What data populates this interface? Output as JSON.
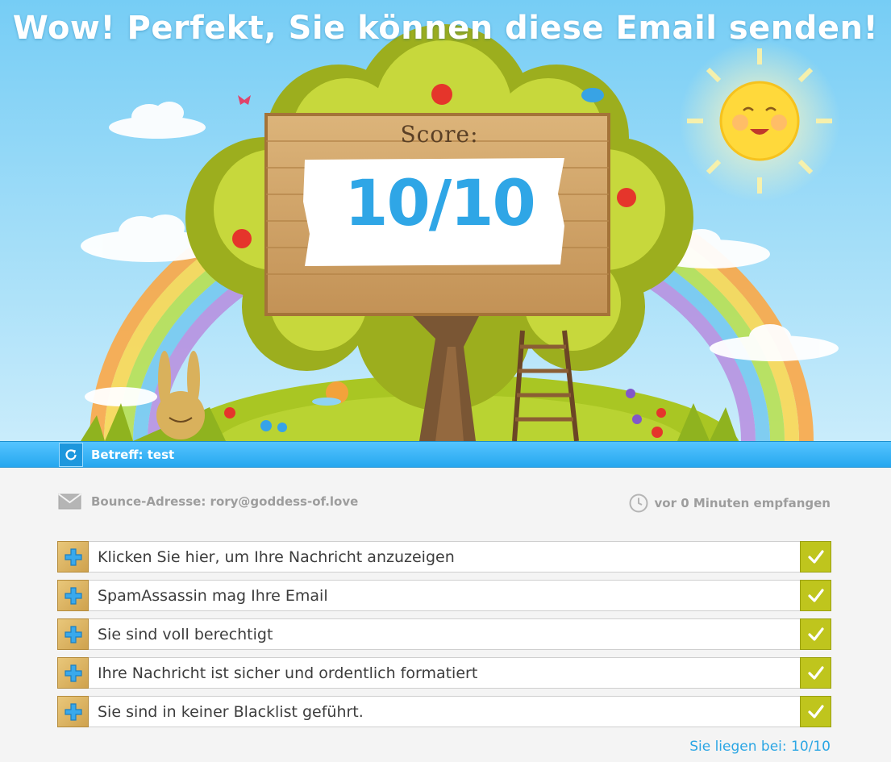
{
  "hero": {
    "headline": "Wow! Perfekt, Sie können diese Email senden!",
    "score_label": "Score:",
    "score_value": "10/10"
  },
  "subject_bar": {
    "subject": "Betreff: test"
  },
  "meta": {
    "bounce": "Bounce-Adresse: rory@goddess-of.love",
    "received": "vor 0 Minuten empfangen"
  },
  "checks": [
    {
      "label": "Klicken Sie hier, um Ihre Nachricht anzuzeigen",
      "status": "ok"
    },
    {
      "label": "SpamAssassin mag Ihre Email",
      "status": "ok"
    },
    {
      "label": "Sie sind voll berechtigt",
      "status": "ok"
    },
    {
      "label": "Ihre Nachricht ist sicher und ordentlich formatiert",
      "status": "ok"
    },
    {
      "label": "Sie sind in keiner Blacklist geführt.",
      "status": "ok"
    }
  ],
  "summary": "Sie liegen bei: 10/10",
  "colors": {
    "accent_blue": "#2ba6e4",
    "ok_green": "#bfc51d",
    "sky": "#8fd6f7"
  }
}
